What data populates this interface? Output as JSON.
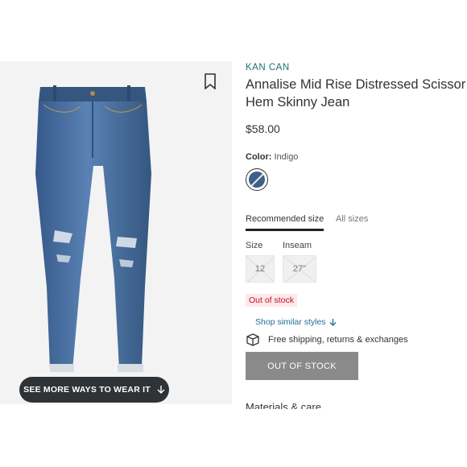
{
  "product": {
    "brand": "KAN CAN",
    "title": "Annalise Mid Rise Distressed Scissor Hem Skinny Jean",
    "price": "$58.00",
    "color_label": "Color:",
    "color_value": "Indigo",
    "color_swatch": "#3e5f86"
  },
  "size_tabs": {
    "recommended": "Recommended size",
    "all": "All sizes"
  },
  "size": {
    "size_label": "Size",
    "inseam_label": "Inseam",
    "size_value": "12",
    "inseam_value": "27\""
  },
  "stock_status": "Out of stock",
  "similar_link": "Shop similar styles",
  "shipping_text": "Free shipping, returns & exchanges",
  "out_of_stock_button": "OUT OF STOCK",
  "materials_heading": "Materials & care",
  "wear_button": "SEE MORE WAYS TO WEAR IT",
  "icons": {
    "bookmark": "bookmark-icon",
    "arrow_down": "arrow-down-icon",
    "package": "package-icon"
  },
  "colors": {
    "brand": "#1f6f6b",
    "link": "#1f6f9b",
    "stock_red": "#c8102e",
    "button_dark": "#2f3336",
    "button_disabled": "#8a8a8a"
  }
}
